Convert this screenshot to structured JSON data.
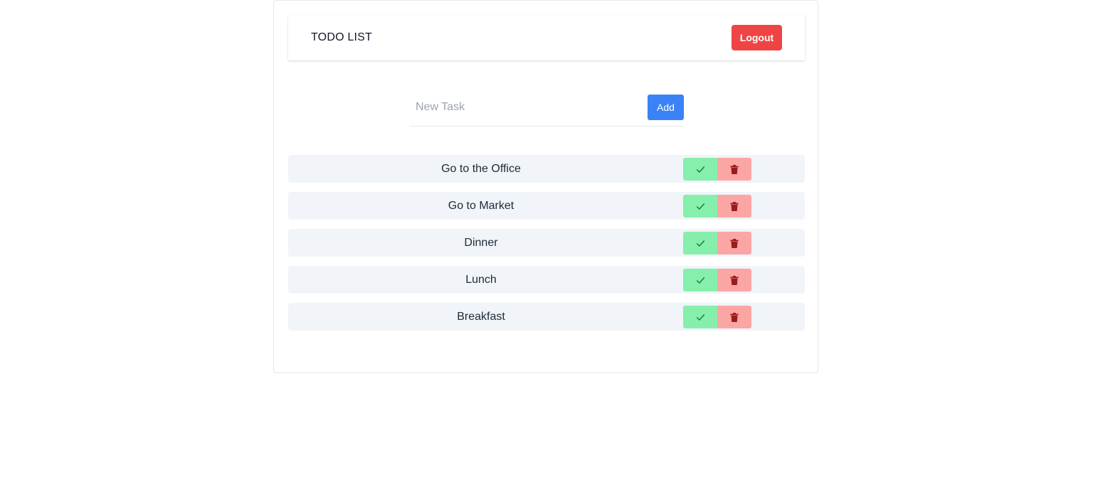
{
  "header": {
    "title": "TODO LIST",
    "logout_label": "Logout"
  },
  "new_task": {
    "placeholder": "New Task",
    "value": "",
    "add_label": "Add"
  },
  "tasks": [
    {
      "text": "Go to the Office"
    },
    {
      "text": "Go to Market"
    },
    {
      "text": "Dinner"
    },
    {
      "text": "Lunch"
    },
    {
      "text": "Breakfast"
    }
  ],
  "icons": {
    "done": "check-icon",
    "delete": "trash-icon"
  },
  "colors": {
    "logout": "#ef4444",
    "add": "#3b82f6",
    "done_bg": "#86efac",
    "done_icon": "#15803d",
    "delete_bg": "#fca5a5",
    "delete_icon": "#991b1b",
    "row_bg": "#f1f4f8"
  }
}
